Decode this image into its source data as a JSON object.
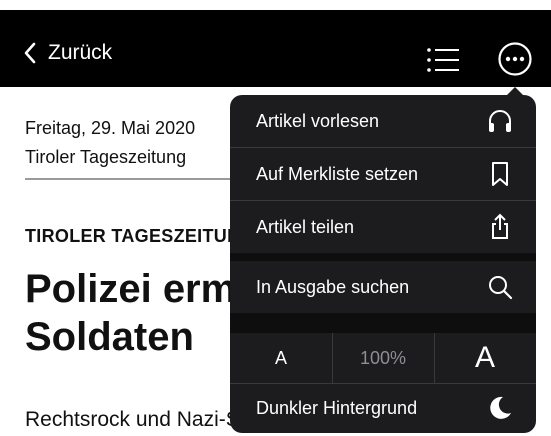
{
  "nav": {
    "back_label": "Zurück"
  },
  "article": {
    "date": "Freitag, 29. Mai 2020",
    "source": "Tiroler Tageszeitung",
    "kicker": "TIROLER TAGESZEITUNG",
    "headline_line1": "Polizei ermittelt gegen",
    "headline_line2": "Soldaten",
    "lead": "Rechtsrock und Nazi-Symbole in"
  },
  "menu": {
    "items": [
      {
        "label": "Artikel vorlesen",
        "icon": "headphones-icon"
      },
      {
        "label": "Auf Merkliste setzen",
        "icon": "bookmark-icon"
      },
      {
        "label": "Artikel teilen",
        "icon": "share-icon"
      },
      {
        "label": "In Ausgabe suchen",
        "icon": "search-icon"
      }
    ],
    "font_small": "A",
    "font_zoom": "100%",
    "font_large": "A",
    "dark_mode_label": "Dunkler Hintergrund",
    "dark_mode_icon": "moon-icon"
  },
  "colors": {
    "navbar": "#000000",
    "menu_bg": "#1c1c1e",
    "menu_text": "#ffffff",
    "menu_muted": "#8e8e93"
  }
}
